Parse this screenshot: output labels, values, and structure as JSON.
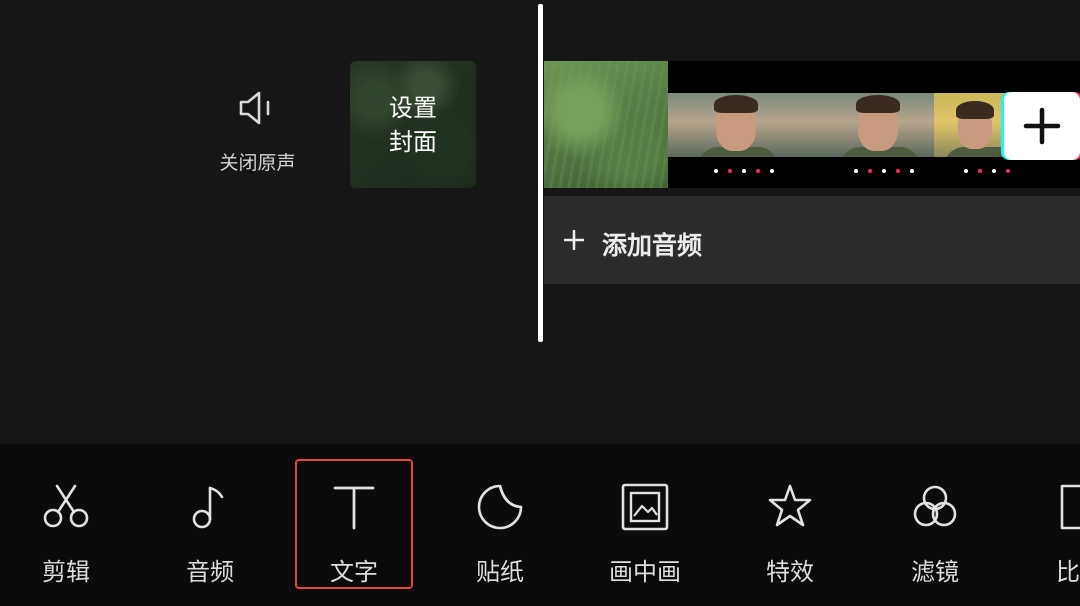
{
  "editor": {
    "mute": {
      "label": "关闭原声",
      "icon": "speaker-icon"
    },
    "cover": {
      "line1": "设置",
      "line2": "封面"
    },
    "add_clip": {
      "icon": "plus-icon"
    },
    "add_audio": {
      "label": "添加音频",
      "icon": "plus-icon"
    }
  },
  "toolbar": {
    "items": [
      {
        "id": "edit",
        "label": "剪辑",
        "icon": "scissors-icon"
      },
      {
        "id": "audio",
        "label": "音频",
        "icon": "music-note-icon"
      },
      {
        "id": "text",
        "label": "文字",
        "icon": "text-t-icon",
        "highlighted": true
      },
      {
        "id": "sticker",
        "label": "贴纸",
        "icon": "sticker-icon"
      },
      {
        "id": "pip",
        "label": "画中画",
        "icon": "picture-in-picture-icon"
      },
      {
        "id": "effects",
        "label": "特效",
        "icon": "star-effect-icon"
      },
      {
        "id": "filter",
        "label": "滤镜",
        "icon": "filter-circles-icon"
      },
      {
        "id": "ratio",
        "label": "比",
        "icon": "ratio-icon"
      }
    ]
  },
  "colors": {
    "background": "#161616",
    "toolbar": "#0b0b0b",
    "highlight": "#e5473c",
    "audio_bar": "#2c2c2c"
  }
}
